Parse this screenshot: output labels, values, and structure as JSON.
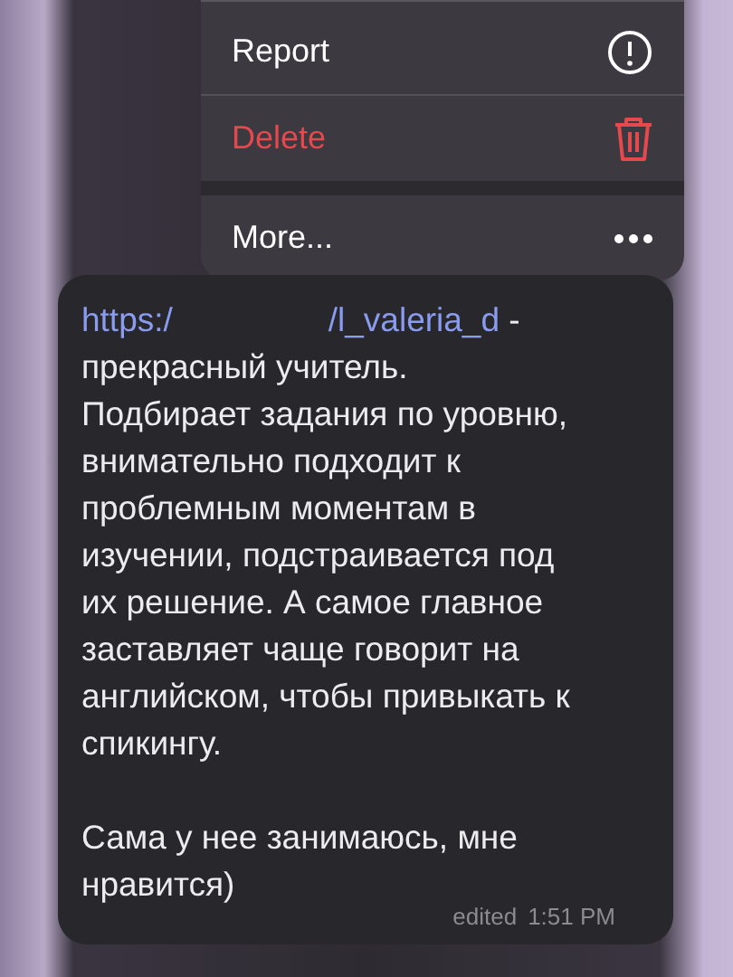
{
  "context_menu": {
    "items": [
      {
        "label": "Report",
        "kind": "report",
        "destructive": false
      },
      {
        "label": "Delete",
        "kind": "delete",
        "destructive": true
      },
      {
        "label": "More...",
        "kind": "more",
        "destructive": false
      }
    ]
  },
  "message": {
    "links": [
      "https:/",
      "/l_valeria_d"
    ],
    "text": " -\nпрекрасный учитель.\nПодбирает задания по уровню,\nвнимательно подходит к\nпроблемным моментам в\nизучении, подстраивается под\nих решение. А самое главное\nзаставляет чаще говорит на\nанглийском, чтобы привыкать к\nспикингу.\n\nСама у нее занимаюсь, мне\nнравится)",
    "edited": "edited",
    "time": "1:51 PM"
  }
}
